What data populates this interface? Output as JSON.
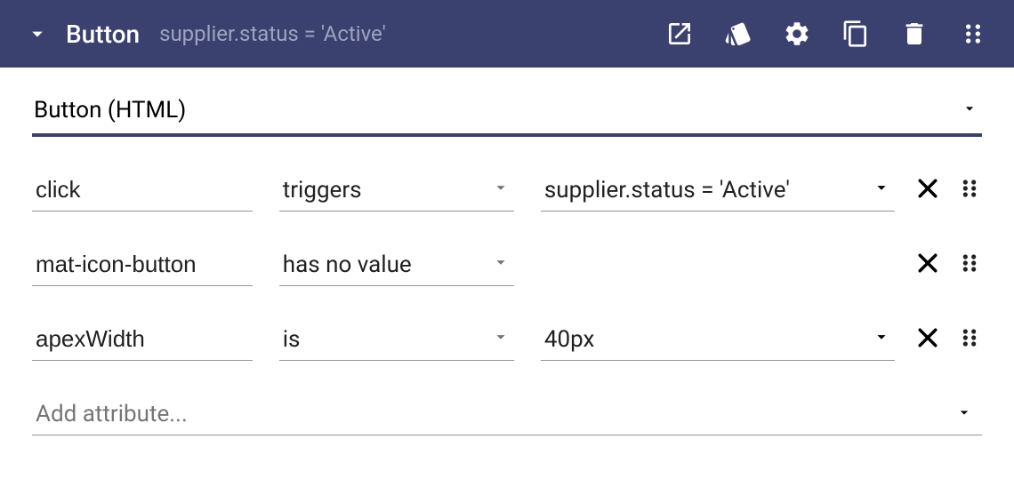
{
  "header": {
    "title": "Button",
    "subtitle": "supplier.status = 'Active'"
  },
  "component_type": "Button (HTML)",
  "rows": [
    {
      "attribute": "click",
      "operator": "triggers",
      "value": "supplier.status = 'Active'",
      "hasValue": true
    },
    {
      "attribute": "mat-icon-button",
      "operator": "has no value",
      "value": "",
      "hasValue": false
    },
    {
      "attribute": "apexWidth",
      "operator": "is",
      "value": "40px",
      "hasValue": true
    }
  ],
  "add_attribute_placeholder": "Add attribute..."
}
